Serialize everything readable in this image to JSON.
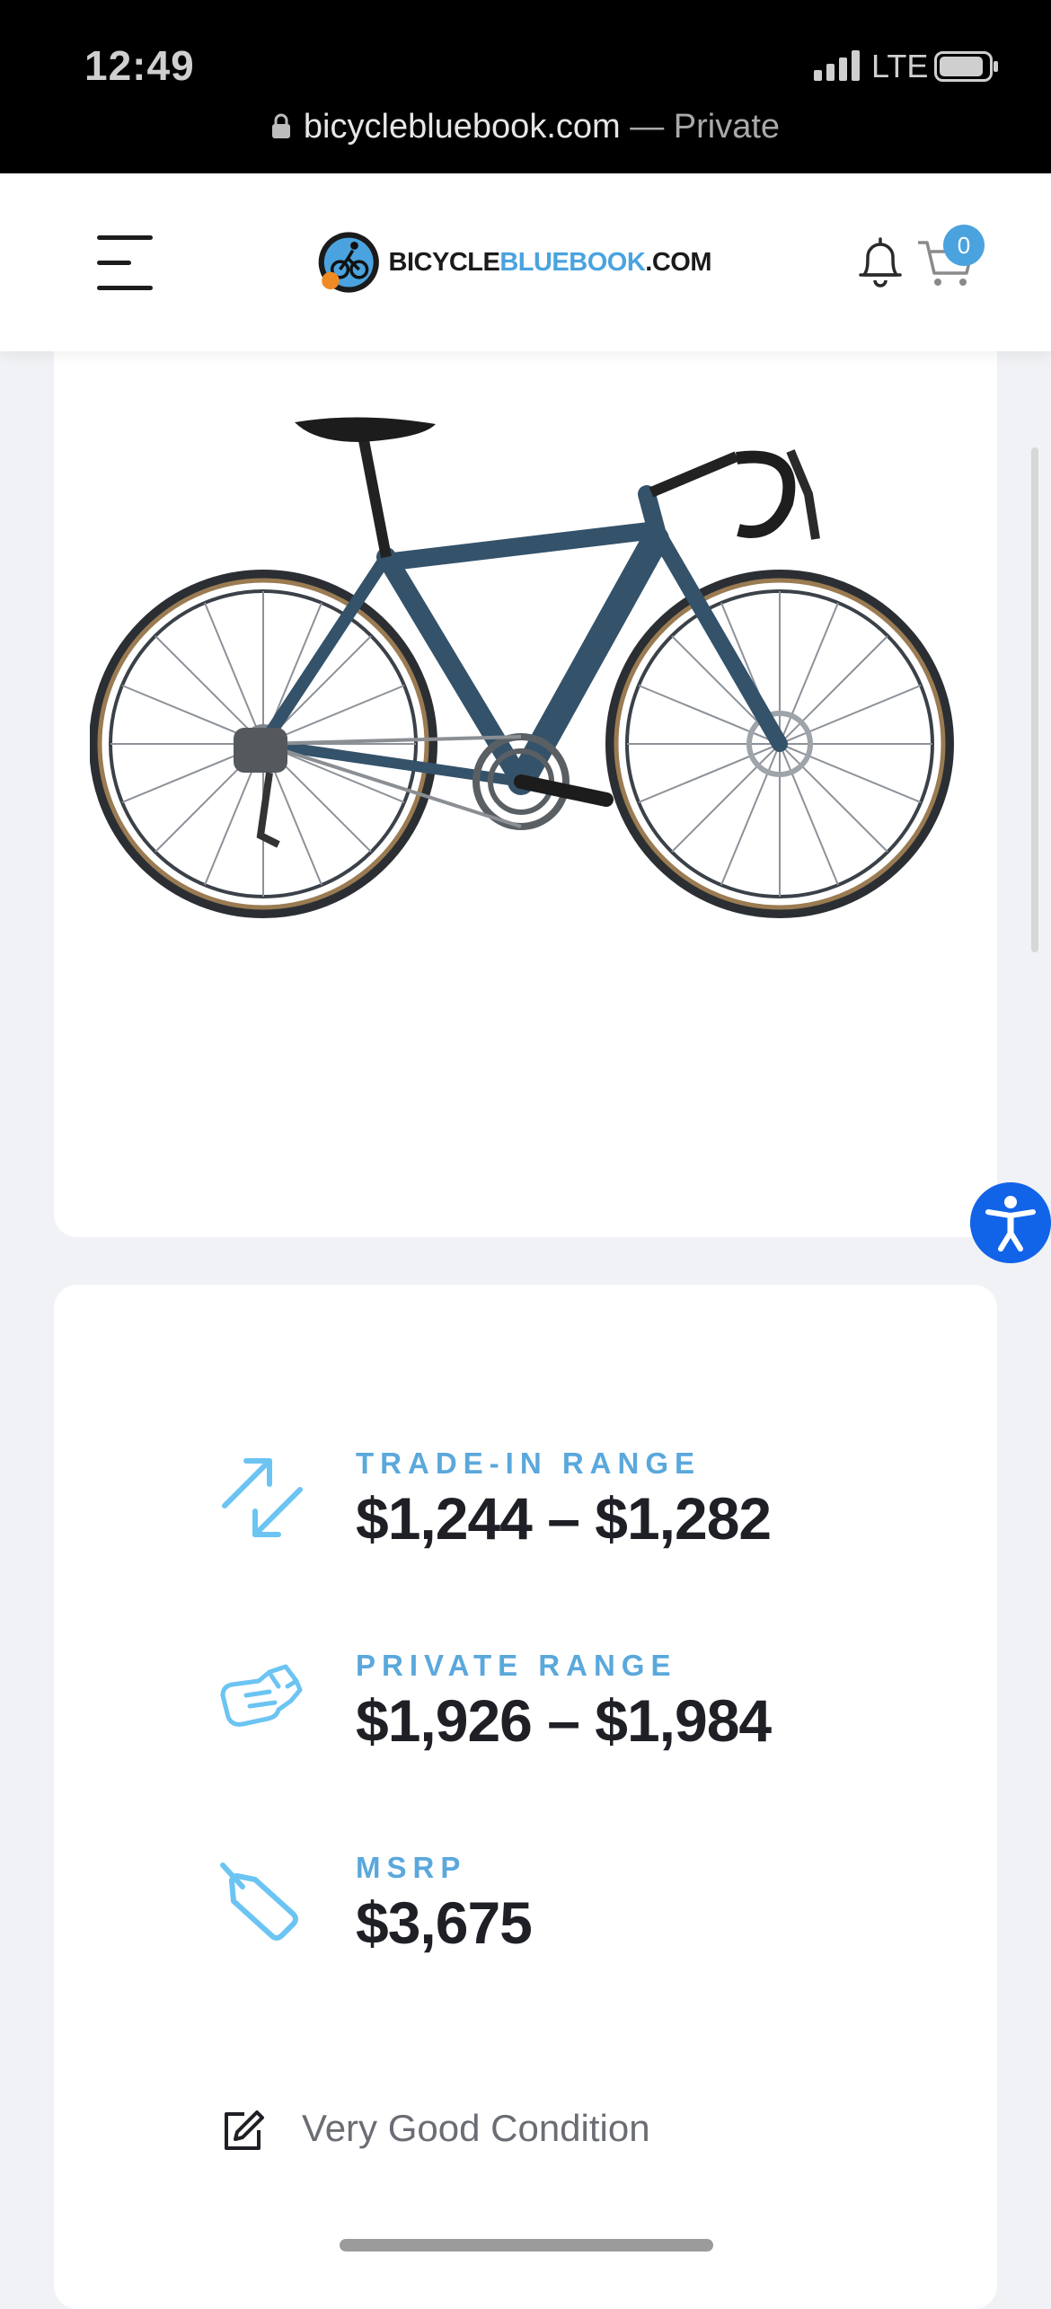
{
  "status_bar": {
    "time": "12:49",
    "network": "LTE"
  },
  "browser": {
    "domain": "bicyclebluebook.com",
    "mode": "Private",
    "separator": "—"
  },
  "header": {
    "logo_text_dark": "BICYCLE",
    "logo_text_blue": "BLUEBOOK",
    "logo_text_suffix": ".COM",
    "cart_count": "0"
  },
  "prices": [
    {
      "label": "TRADE-IN RANGE",
      "value": "$1,244 – $1,282",
      "icon": "arrows-swap-icon"
    },
    {
      "label": "PRIVATE RANGE",
      "value": "$1,926 – $1,984",
      "icon": "handshake-icon"
    },
    {
      "label": "MSRP",
      "value": "$3,675",
      "icon": "price-tag-icon"
    }
  ],
  "condition": {
    "text": "Very Good Condition",
    "icon": "edit-icon"
  },
  "colors": {
    "accent": "#4aa3df",
    "label": "#5aa8dc",
    "price": "#1f2026",
    "a11y": "#1164e8"
  }
}
